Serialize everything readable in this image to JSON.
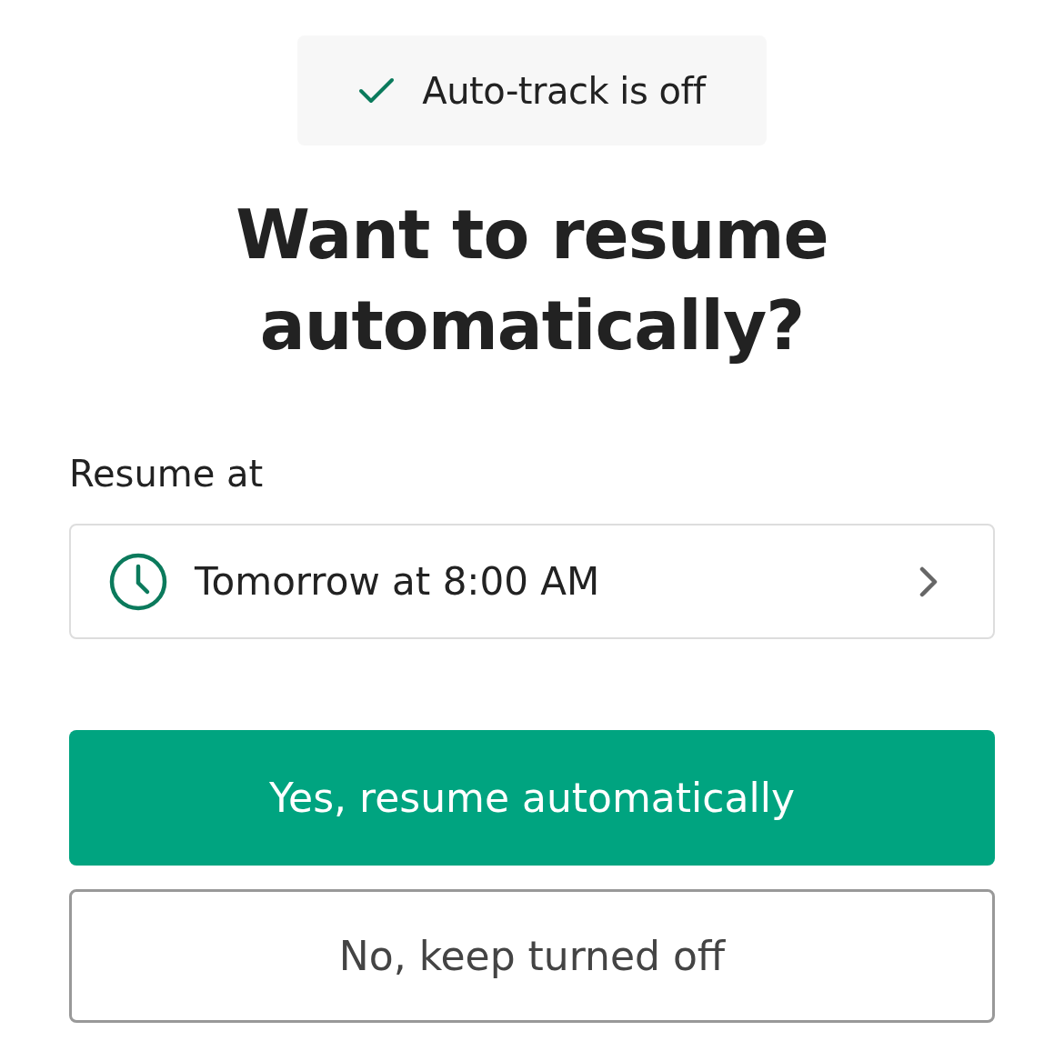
{
  "toast": {
    "text": "Auto-track is off"
  },
  "heading": "Want to resume automatically?",
  "resume": {
    "label": "Resume at",
    "value": "Tomorrow at 8:00 AM"
  },
  "buttons": [
    {
      "label": "Yes, resume automatically",
      "kind": "primary"
    },
    {
      "label": "No, keep turned off",
      "kind": "secondary"
    }
  ]
}
